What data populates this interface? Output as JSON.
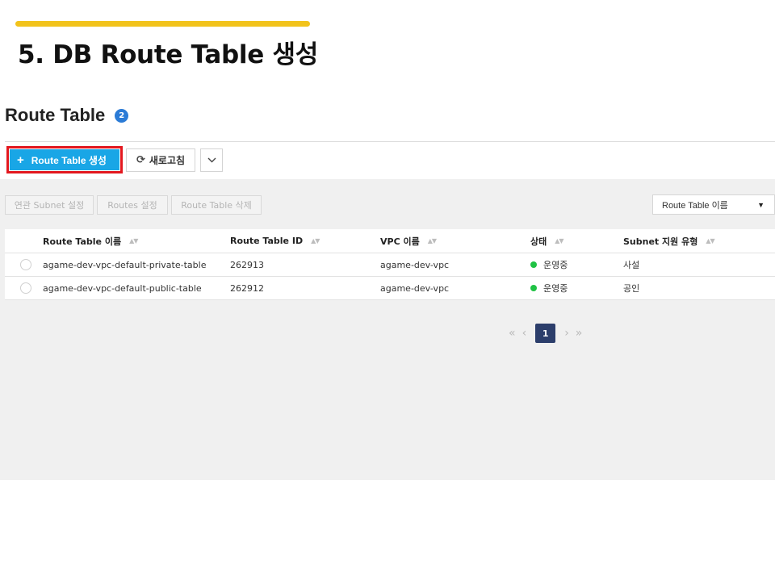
{
  "slide": {
    "title": "5. DB Route Table 생성",
    "accent_color": "#f2c31b"
  },
  "page": {
    "title": "Route Table",
    "count": "2"
  },
  "toolbar": {
    "create_label": "Route Table 생성",
    "refresh_label": "새로고침",
    "create_color": "#19a6e6",
    "highlight_color": "#e3181f"
  },
  "actions": {
    "subnet_label": "연관 Subnet 설정",
    "routes_label": "Routes 설정",
    "delete_label": "Route Table 삭제"
  },
  "filter": {
    "selected": "Route Table 이름"
  },
  "table": {
    "columns": [
      "Route Table 이름",
      "Route Table ID",
      "VPC 이름",
      "상태",
      "Subnet 지원 유형"
    ],
    "rows": [
      {
        "name": "agame-dev-vpc-default-private-table",
        "id": "262913",
        "vpc": "agame-dev-vpc",
        "status": "운영중",
        "subnet_type": "사설"
      },
      {
        "name": "agame-dev-vpc-default-public-table",
        "id": "262912",
        "vpc": "agame-dev-vpc",
        "status": "운영중",
        "subnet_type": "공인"
      }
    ],
    "status_color": "#1fc244"
  },
  "pagination": {
    "current_page": "1"
  }
}
